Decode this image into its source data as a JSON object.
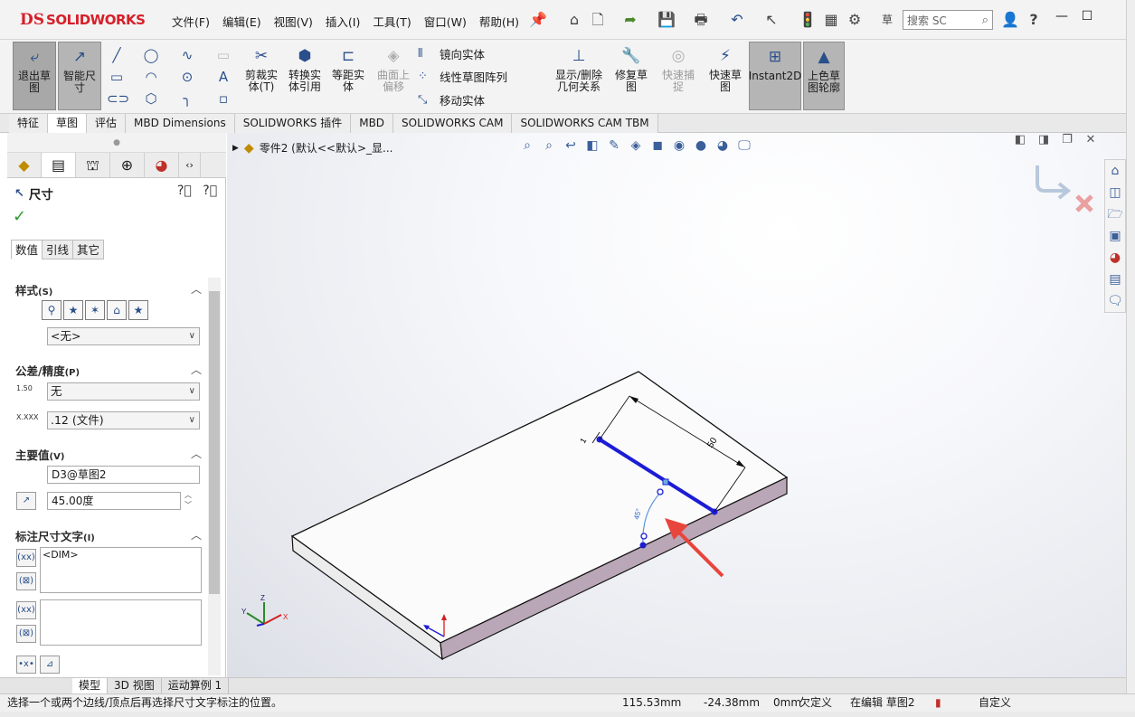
{
  "app": {
    "logo_ds": "DS",
    "logo_text": "SOLIDWORKS",
    "search_placeholder": "搜索 SC"
  },
  "menu": [
    "文件(F)",
    "编辑(E)",
    "视图(V)",
    "插入(I)",
    "工具(T)",
    "窗口(W)",
    "帮助(H)"
  ],
  "ribbon": {
    "exit_sketch": "退出草图",
    "smart_dim": "智能尺寸",
    "trim": "剪裁实体(T)",
    "convert": "转换实体引用",
    "offset": "等距实体",
    "surface_offset": "曲面上偏移",
    "mirror": "镜向实体",
    "linear_pattern": "线性草图阵列",
    "move": "移动实体",
    "display_delete": "显示/删除几何关系",
    "repair": "修复草图",
    "quick_snap": "快速捕捉",
    "rapid_sketch": "快速草图",
    "instant2d": "Instant2D",
    "shaded_contours": "上色草图轮廓"
  },
  "tabs": [
    {
      "label": "特征",
      "active": false
    },
    {
      "label": "草图",
      "active": true
    },
    {
      "label": "评估",
      "active": false
    },
    {
      "label": "MBD Dimensions",
      "active": false
    },
    {
      "label": "SOLIDWORKS 插件",
      "active": false
    },
    {
      "label": "MBD",
      "active": false
    },
    {
      "label": "SOLIDWORKS CAM",
      "active": false
    },
    {
      "label": "SOLIDWORKS CAM TBM",
      "active": false
    }
  ],
  "panel": {
    "title": "尺寸",
    "subtabs": [
      "数值",
      "引线",
      "其它"
    ],
    "style_section": "样式",
    "style_key": "(S)",
    "style_value": "<无>",
    "tol_section": "公差/精度",
    "tol_key": "(P)",
    "tol_icon": "1.50",
    "tol_value": "无",
    "precision_icon": "X.XXX",
    "precision_value": ".12 (文件)",
    "primary_section": "主要值",
    "primary_key": "(V)",
    "dim_name": "D3@草图2",
    "dim_value": "45.00度",
    "dimtext_section": "标注尺寸文字",
    "dimtext_key": "(I)",
    "dimtext_value": "<DIM>"
  },
  "viewport": {
    "tree_text": "零件2  (默认<<默认>_显...",
    "dim_label_50": "50",
    "dim_label_angle": "45°",
    "dim_label_small": "1"
  },
  "bottom_tabs": [
    {
      "label": "模型",
      "active": true
    },
    {
      "label": "3D 视图",
      "active": false
    },
    {
      "label": "运动算例 1",
      "active": false
    }
  ],
  "status": {
    "message": "选择一个或两个边线/顶点后再选择尺寸文字标注的位置。",
    "x": "115.53mm",
    "y": "-24.38mm",
    "z": "0mm",
    "defined": "欠定义",
    "editing": "在编辑 草图2",
    "units": "自定义"
  },
  "colors": {
    "brand": "#d6202a",
    "sketch_line": "#1c1cd6",
    "plate_side": "#b9a6b6",
    "arrow": "#e8453c",
    "ok": "#2e9a2e"
  }
}
